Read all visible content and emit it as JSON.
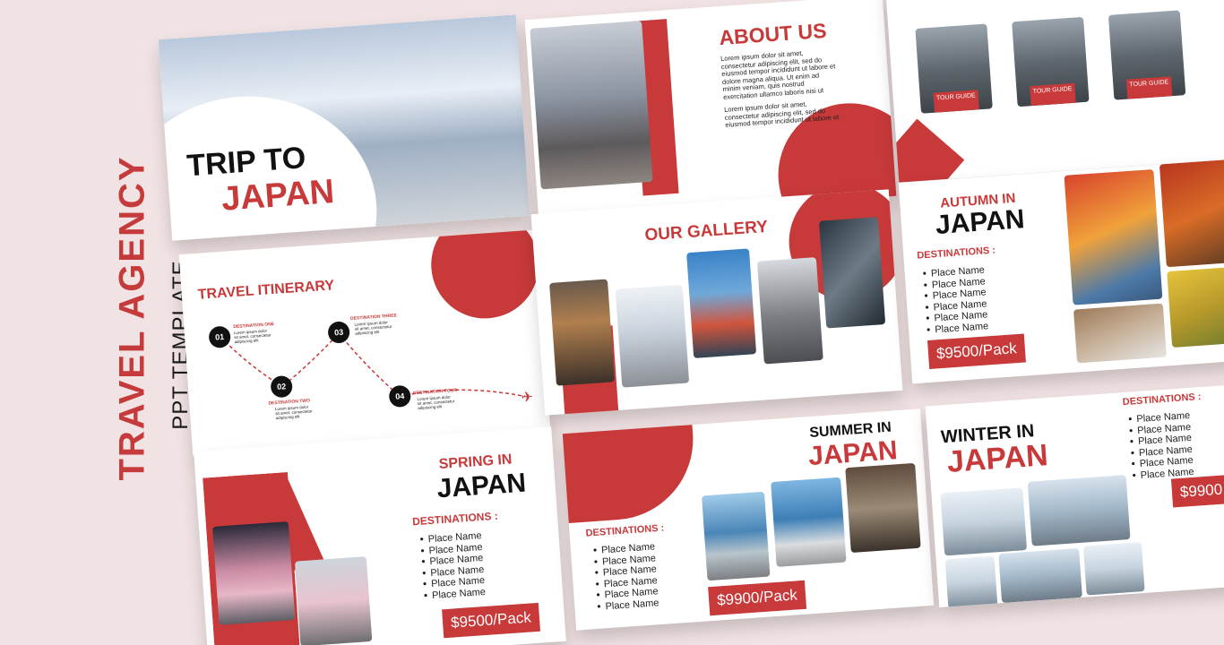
{
  "side": {
    "title": "TRAVEL AGENCY",
    "subtitle": "PPT TEMPLATE"
  },
  "cover": {
    "line1": "TRIP TO",
    "line2": "JAPAN"
  },
  "about": {
    "title": "ABOUT US",
    "para1": "Lorem ipsum dolor sit amet, consectetur adipiscing elit, sed do eiusmod tempor incididunt ut labore et dolore magna aliqua. Ut enim ad minim veniam, quis nostrud exercitation ullamco laboris nisi ut",
    "para2": "Lorem ipsum dolor sit amet, consectetur adipiscing elit, sed do eiusmod tempor incididunt ut labore et"
  },
  "team": {
    "role1": "TOUR GUIDE",
    "role2": "TOUR GUIDE",
    "role3": "TOUR GUIDE"
  },
  "itinerary": {
    "title": "TRAVEL ITINERARY",
    "stops": [
      {
        "num": "01",
        "label": "DESTINATION ONE",
        "text": "Lorem ipsum dolor sit amet, consectetur adipiscing elit"
      },
      {
        "num": "02",
        "label": "DESTINATION TWO",
        "text": "Lorem ipsum dolor sit amet, consectetur adipiscing elit"
      },
      {
        "num": "03",
        "label": "DESTINATION THREE",
        "text": "Lorem ipsum dolor sit amet, consectetur adipiscing elit"
      },
      {
        "num": "04",
        "label": "DESTINATION FOUR",
        "text": "Lorem ipsum dolor sit amet, consectetur adipiscing elit"
      }
    ]
  },
  "gallery": {
    "title": "OUR GALLERY"
  },
  "autumn": {
    "line1": "AUTUMN IN",
    "line2": "JAPAN",
    "dest": "DESTINATIONS :",
    "places": [
      "Place Name",
      "Place Name",
      "Place Name",
      "Place Name",
      "Place Name",
      "Place Name"
    ],
    "price": "$9500/Pack"
  },
  "spring": {
    "line1": "SPRING IN",
    "line2": "JAPAN",
    "dest": "DESTINATIONS :",
    "places": [
      "Place Name",
      "Place Name",
      "Place Name",
      "Place Name",
      "Place Name",
      "Place Name"
    ],
    "price": "$9500/Pack"
  },
  "summer": {
    "line1": "SUMMER IN",
    "line2": "JAPAN",
    "dest": "DESTINATIONS :",
    "places": [
      "Place Name",
      "Place Name",
      "Place Name",
      "Place Name",
      "Place Name",
      "Place Name"
    ],
    "price": "$9900/Pack"
  },
  "winter": {
    "line1": "WINTER IN",
    "line2": "JAPAN",
    "dest": "DESTINATIONS :",
    "places": [
      "Place Name",
      "Place Name",
      "Place Name",
      "Place Name",
      "Place Name",
      "Place Name"
    ],
    "price": "$9900"
  },
  "colors": {
    "accent": "#c8393a",
    "background": "#f1e3e4"
  }
}
